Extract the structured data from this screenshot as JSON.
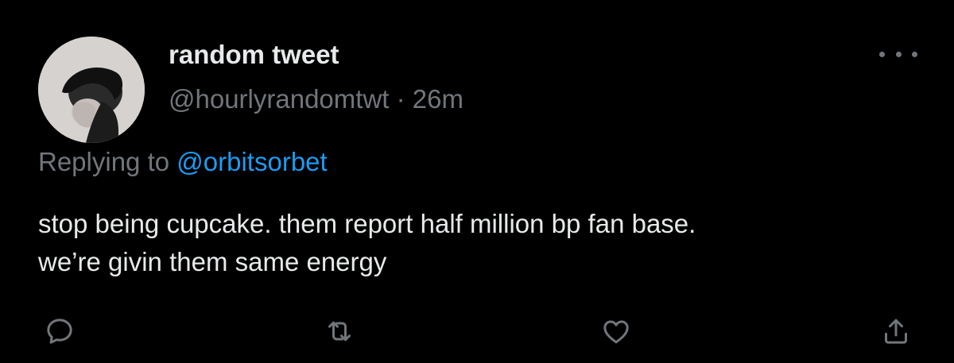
{
  "tweet": {
    "display_name": "random tweet",
    "handle": "@hourlyrandomtwt",
    "separator": "·",
    "time": "26m",
    "replying_prefix": "Replying to",
    "replying_to": "@orbitsorbet",
    "text_lines": [
      "stop being cupcake. them report half million bp fan base.",
      "we’re givin them same energy"
    ],
    "avatar_icon": "profile-photo",
    "more_icon": "ellipsis-icon"
  },
  "actions": [
    {
      "name": "reply",
      "icon": "reply-icon"
    },
    {
      "name": "retweet",
      "icon": "retweet-icon"
    },
    {
      "name": "like",
      "icon": "heart-icon"
    },
    {
      "name": "share",
      "icon": "share-icon"
    }
  ],
  "colors": {
    "background": "#000000",
    "primary_text": "#e7e9ea",
    "secondary_text": "#71767b",
    "link": "#1d9bf0"
  }
}
